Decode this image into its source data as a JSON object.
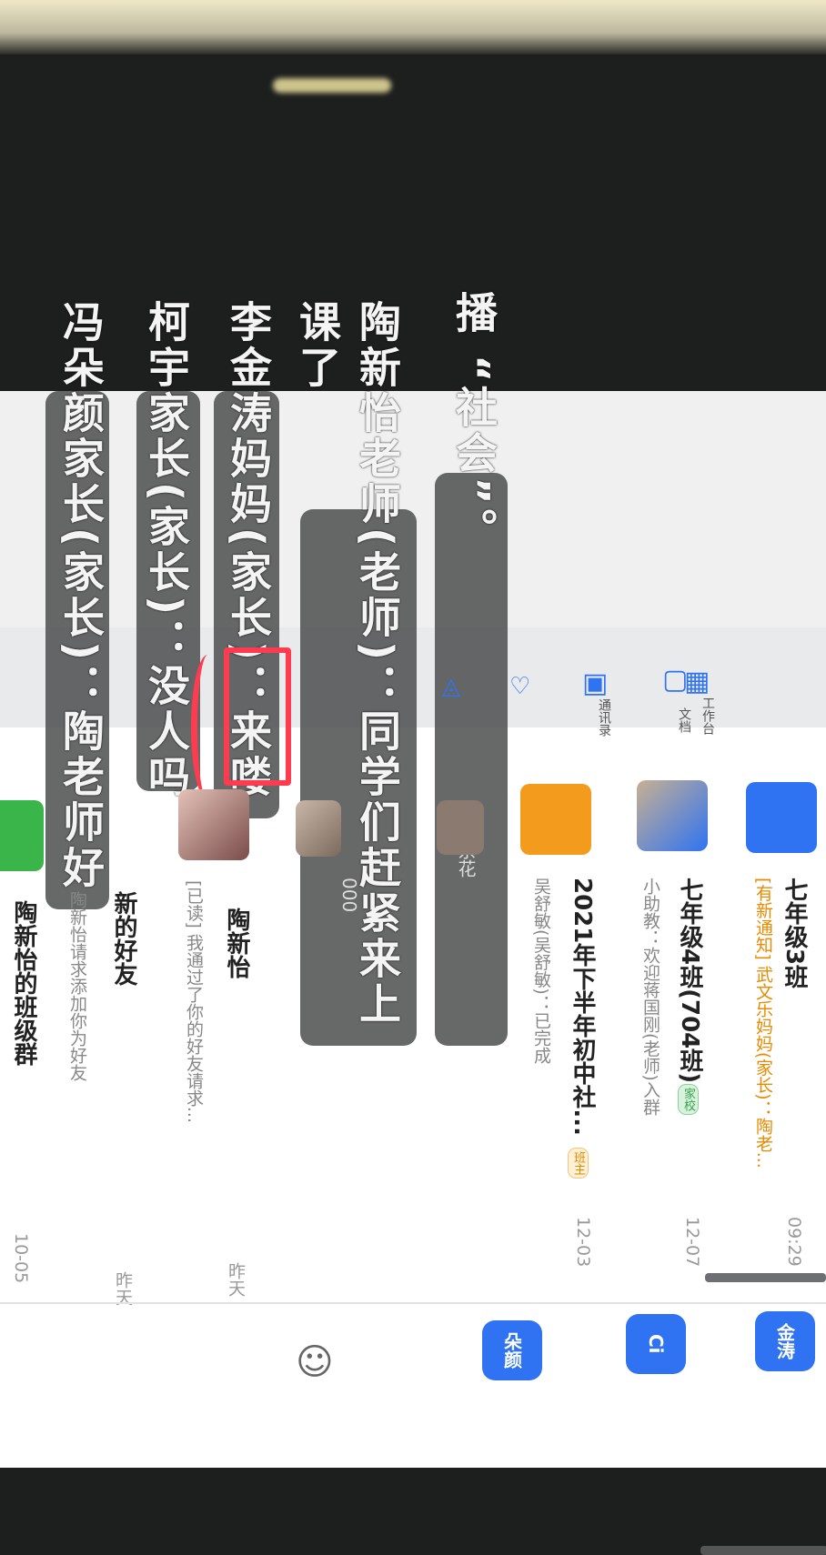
{
  "messages": {
    "line_top": "播 “社会”。",
    "line_tao": "陶新怡老师(老师)：同学们赶紧来上课了",
    "line_li": "李金涛妈妈(家长)：来喽",
    "line_ke": "柯宇家长(家长)：没人吗",
    "line_feng": "冯朵颜家长(家长)：陶老师好"
  },
  "chats": [
    {
      "name": "七年级3班",
      "sub": "[有新通知] 武文乐妈妈(家长)：陶老...",
      "time": "09:29"
    },
    {
      "name": "七年级4班(704班)",
      "tag": "家校",
      "sub": "小助教：欢迎蒋国刚(老师)入群",
      "time": "12-07"
    },
    {
      "name": "2021年下半年初中社...",
      "tag": "班主",
      "sub": "吴舒敏(吴舒敏)：已完成",
      "time": "12-03"
    },
    {
      "name": "陶新怡",
      "sub": "[已读] 我通过了你的好友请求...",
      "time": "昨天"
    },
    {
      "name": "新的好友",
      "sub": "陶新怡请求添加你为好友",
      "time": "昨天"
    },
    {
      "name": "陶新怡的班级群",
      "sub": "",
      "time": "10-05"
    }
  ],
  "popup_names": {
    "a": "张余花",
    "b": "000"
  },
  "sidebar": [
    {
      "label": "文档",
      "icon": "doc-icon"
    },
    {
      "label": "工作台",
      "icon": "grid-icon"
    },
    {
      "label": "通讯录",
      "icon": "contacts-icon"
    }
  ],
  "chips": {
    "c1": "金涛",
    "c2": "Ci",
    "c3": "朵颜"
  },
  "colors": {
    "accent": "#2f73f2",
    "annotation": "#ff3b4f"
  }
}
